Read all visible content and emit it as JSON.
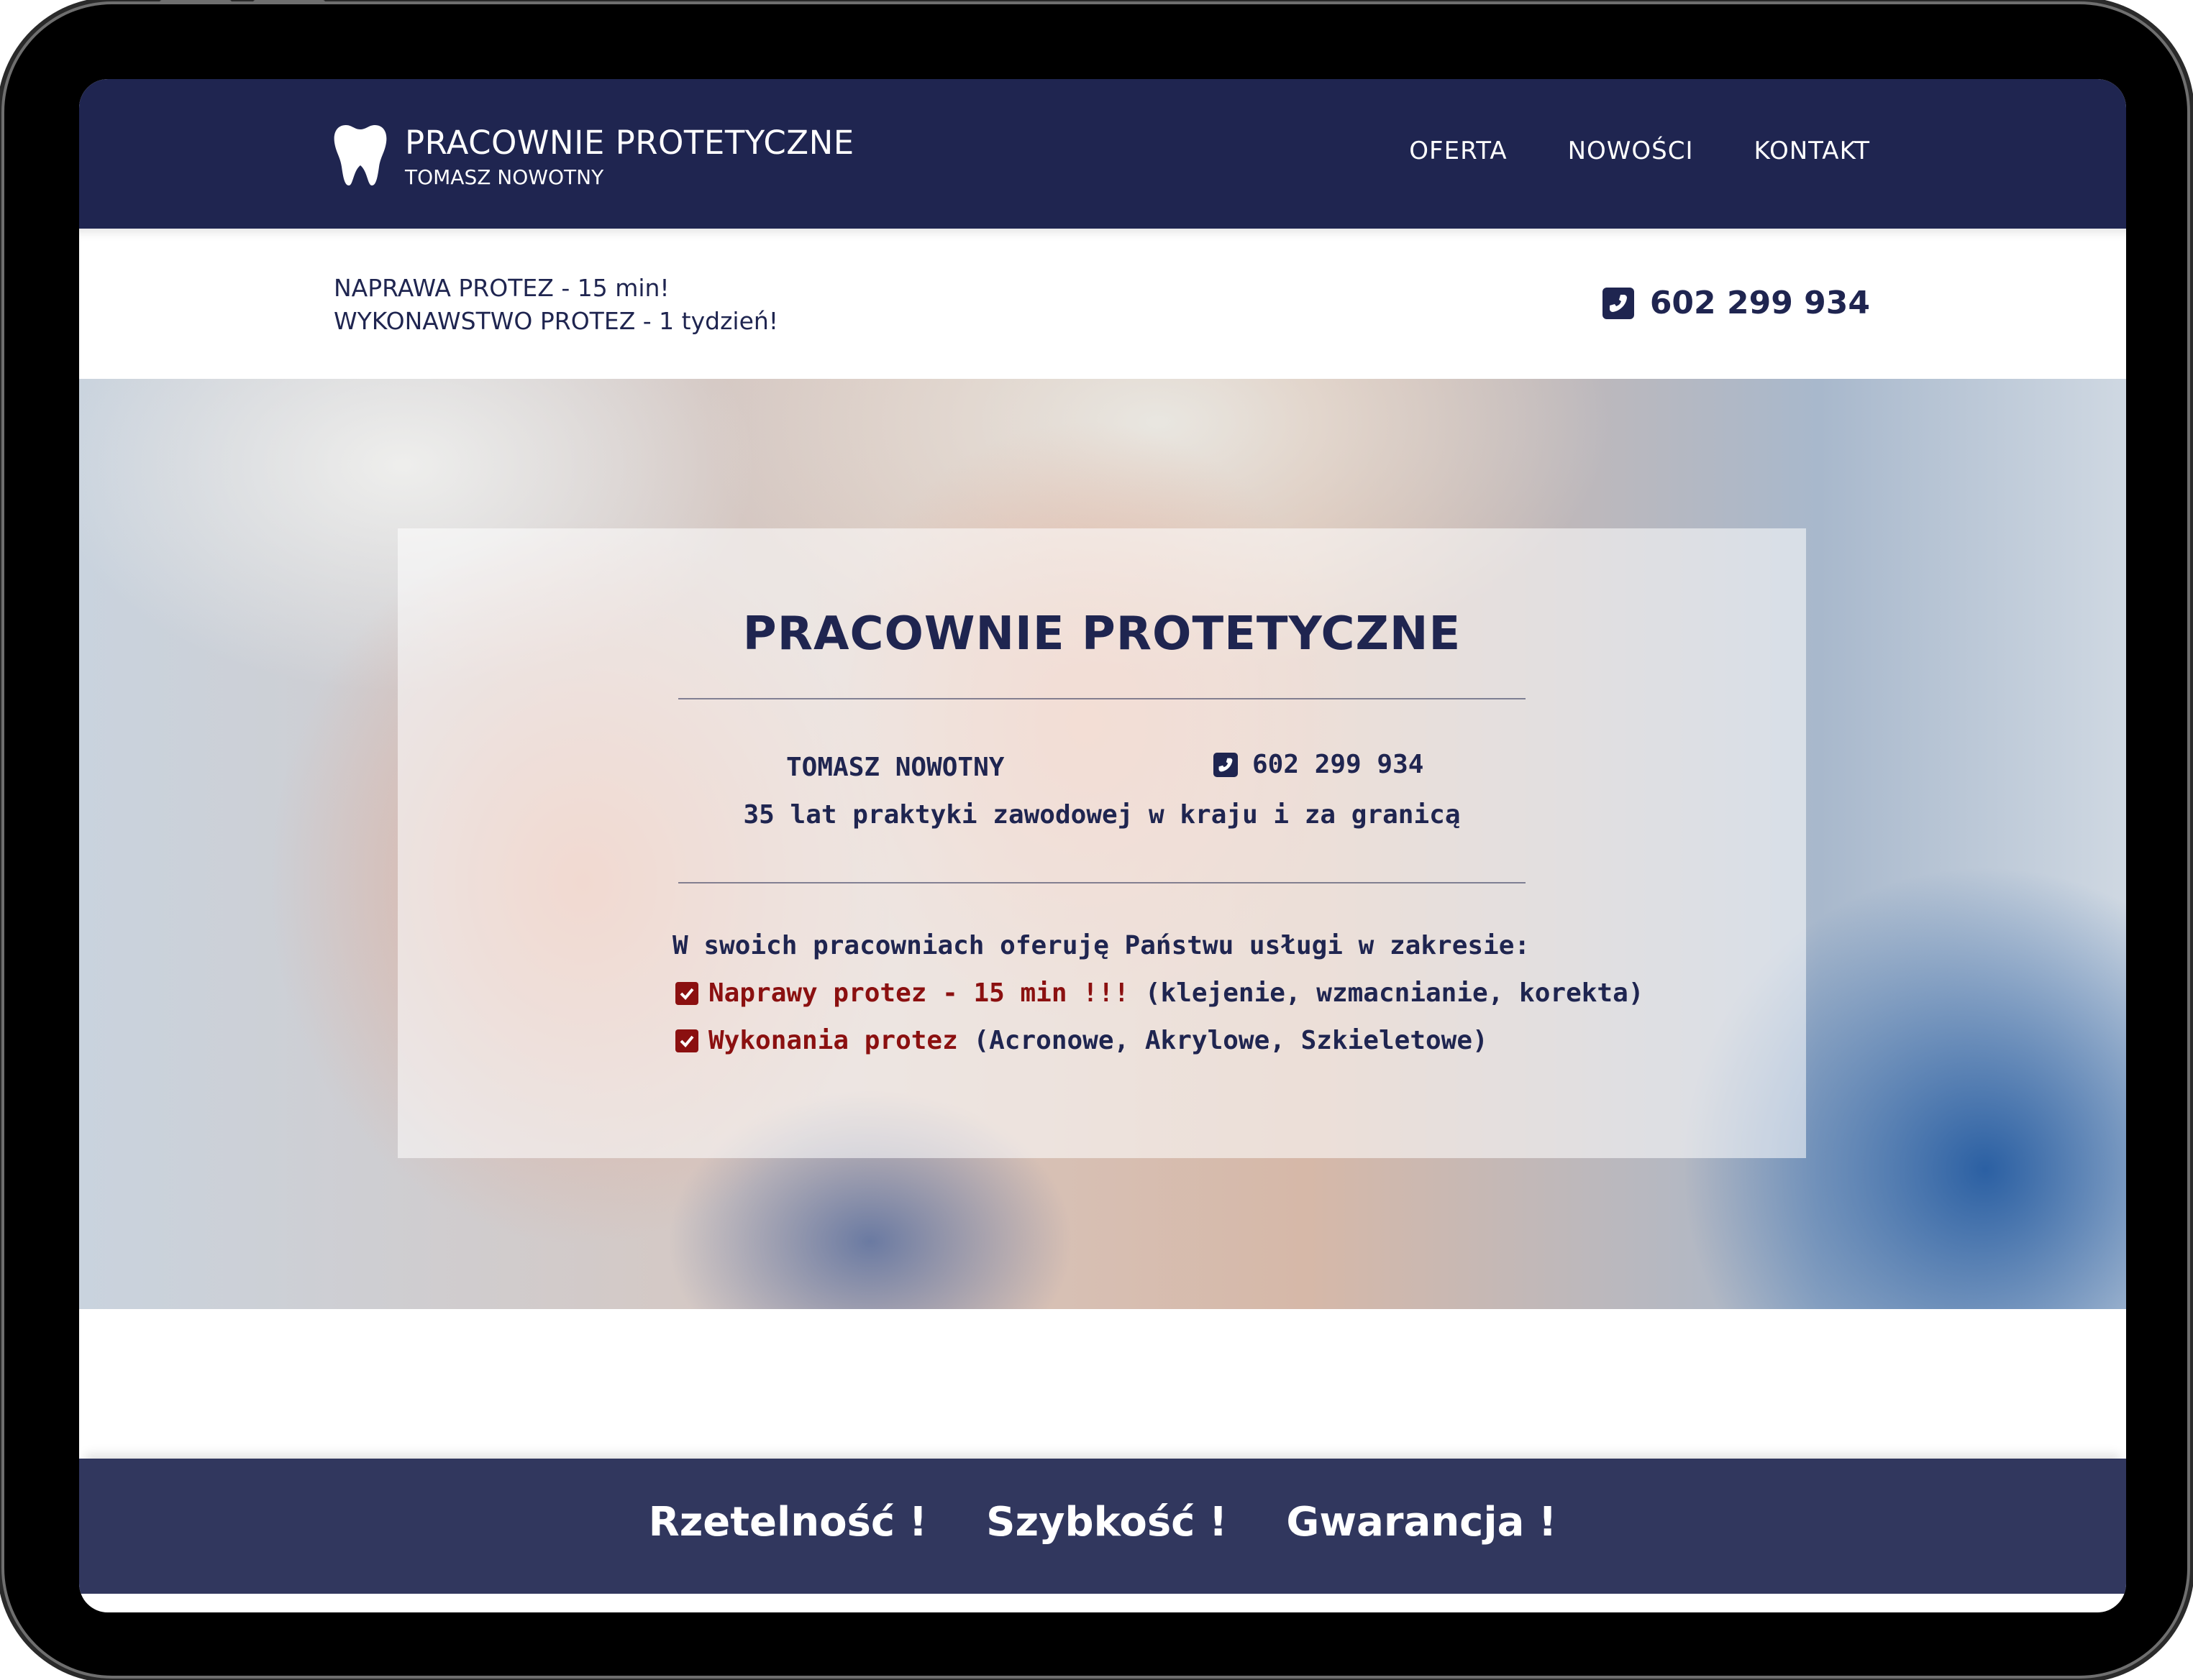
{
  "header": {
    "brand_title": "PRACOWNIE PROTETYCZNE",
    "brand_subtitle": "TOMASZ NOWOTNY",
    "logo_icon": "tooth-icon",
    "nav": [
      {
        "label": "OFERTA"
      },
      {
        "label": "NOWOŚCI"
      },
      {
        "label": "KONTAKT"
      }
    ]
  },
  "infobar": {
    "promo_lines": [
      "NAPRAWA PROTEZ - 15 min!",
      "WYKONAWSTWO PROTEZ - 1 tydzień!"
    ],
    "phone": "602 299 934",
    "phone_icon": "phone-square-icon"
  },
  "hero": {
    "title": "PRACOWNIE PROTETYCZNE",
    "owner": "TOMASZ NOWOTNY",
    "phone": "602 299 934",
    "experience": "35 lat praktyki zawodowej w kraju i za granicą",
    "services_intro": "W swoich pracowniach oferuję Państwu usługi w zakresie:",
    "services": [
      {
        "highlight": "Naprawy protez - 15 min !!!",
        "detail": " (klejenie, wzmacnianie, korekta)"
      },
      {
        "highlight": "Wykonania protez",
        "detail": " (Acronowe, Akrylowe, Szkieletowe)"
      }
    ],
    "check_icon": "check-square-icon"
  },
  "values": [
    "Rzetelność !",
    "Szybkość !",
    "Gwarancja !"
  ],
  "colors": {
    "navy": "#1f2550",
    "band": "#31375e",
    "accent_red": "#8b1010"
  }
}
